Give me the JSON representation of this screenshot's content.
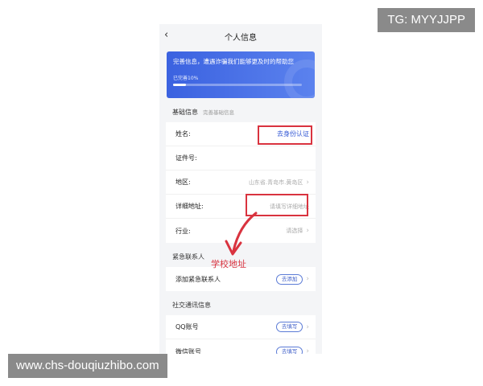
{
  "watermarks": {
    "top": "TG: MYYJJPP",
    "bottom": "www.chs-douqiuzhibo.com"
  },
  "nav": {
    "back_glyph": "‹",
    "title": "个人信息"
  },
  "banner": {
    "message": "完善信息，遭遇诈骗我们能够更及时的帮助您",
    "progress_label": "已完善10%",
    "progress_fraction": 0.1
  },
  "basic": {
    "heading": "基础信息",
    "subheading": "完善基础信息",
    "rows": [
      {
        "label": "姓名:",
        "value": "去身份认证"
      },
      {
        "label": "证件号:",
        "value": ""
      },
      {
        "label": "地区:",
        "value": "山东省.青岛市.黄岛区"
      },
      {
        "label": "详细地址:",
        "value": "请填写详细地址"
      },
      {
        "label": "行业:",
        "value": "请选择"
      }
    ]
  },
  "emergency": {
    "heading": "紧急联系人",
    "row": {
      "label": "添加紧急联系人",
      "button": "去添加"
    }
  },
  "social": {
    "heading": "社交通讯信息",
    "rows": [
      {
        "label": "QQ账号",
        "button": "去填写"
      },
      {
        "label": "微信账号",
        "button": "去填写"
      }
    ]
  },
  "annotation": {
    "text": "学校地址"
  },
  "colors": {
    "accent": "#3b62e0",
    "annotation_red": "#d9333f",
    "link_blue": "#2f55d4"
  }
}
